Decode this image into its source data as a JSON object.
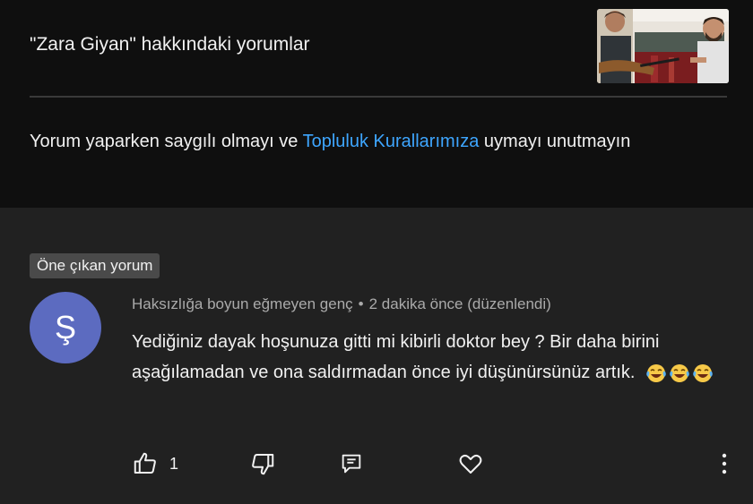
{
  "header": {
    "title": "\"Zara Giyan\" hakkındaki yorumlar",
    "notice_before": "Yorum yaparken saygılı olmayı ve ",
    "notice_link": "Topluluk Kurallarımıza",
    "notice_after": " uymayı unutmayın"
  },
  "comment": {
    "badge": "Öne çıkan yorum",
    "avatar_letter": "Ş",
    "avatar_color": "#5c6bc0",
    "author": "Haksızlığa boyun eğmeyen genç",
    "separator": "•",
    "time": "2 dakika önce (düzenlendi)",
    "text": "Yediğiniz dayak hoşunuza gitti mi kibirli doktor bey ? Bir daha birini aşağılamadan ve ona saldırmadan önce iyi düşünürsünüz artık.",
    "like_count": "1"
  },
  "icons": {
    "like": "thumbs-up-icon",
    "dislike": "thumbs-down-icon",
    "reply": "reply-icon",
    "heart": "heart-icon",
    "more": "more-vertical-icon",
    "emoji": "laughing-tears-emoji"
  },
  "colors": {
    "top_background": "#0f0f0f",
    "background": "#212121",
    "link": "#3ea6ff"
  }
}
